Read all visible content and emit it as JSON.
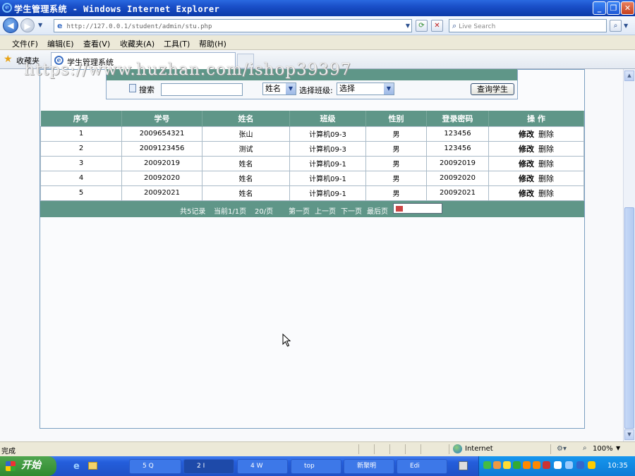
{
  "window": {
    "title": "学生管理系统 - Windows Internet Explorer"
  },
  "nav": {
    "url": "http://127.0.0.1/student/admin/stu.php",
    "search_placeholder": "Live Search"
  },
  "menu": [
    "文件(F)",
    "编辑(E)",
    "查看(V)",
    "收藏夹(A)",
    "工具(T)",
    "帮助(H)"
  ],
  "favbar": {
    "favorites_label": "收藏夹",
    "tab_title": "学生管理系统"
  },
  "watermark": "https://www.huzhan.com/ishop39397",
  "search": {
    "label": "搜索",
    "input_value": "",
    "field_select": "姓名",
    "class_label": "选择班级:",
    "class_select": "选择",
    "submit": "查询学生"
  },
  "table": {
    "headers": [
      "序号",
      "学号",
      "姓名",
      "班级",
      "性别",
      "登录密码",
      "操 作"
    ],
    "rows": [
      [
        "1",
        "2009654321",
        "张山",
        "计算机09-3",
        "男",
        "123456"
      ],
      [
        "2",
        "2009123456",
        "测试",
        "计算机09-3",
        "男",
        "123456"
      ],
      [
        "3",
        "20092019",
        "姓名",
        "计算机09-1",
        "男",
        "20092019"
      ],
      [
        "4",
        "20092020",
        "姓名",
        "计算机09-1",
        "男",
        "20092020"
      ],
      [
        "5",
        "20092021",
        "姓名",
        "计算机09-1",
        "男",
        "20092021"
      ]
    ],
    "edit_label": "修改",
    "delete_label": "删除"
  },
  "pager": {
    "total": "共5记录",
    "current": "当前1/1页",
    "per_page": "20/页",
    "first": "第一页",
    "prev": "上一页",
    "next": "下一页",
    "last": "最后页"
  },
  "status": {
    "left": "完成",
    "zone": "Internet",
    "zoom": "100%"
  },
  "taskbar": {
    "start": "开始",
    "items": [
      "5 Q",
      "2 I",
      "4 W",
      "top",
      "新聚明",
      "Edi"
    ],
    "clock": "10:35"
  }
}
